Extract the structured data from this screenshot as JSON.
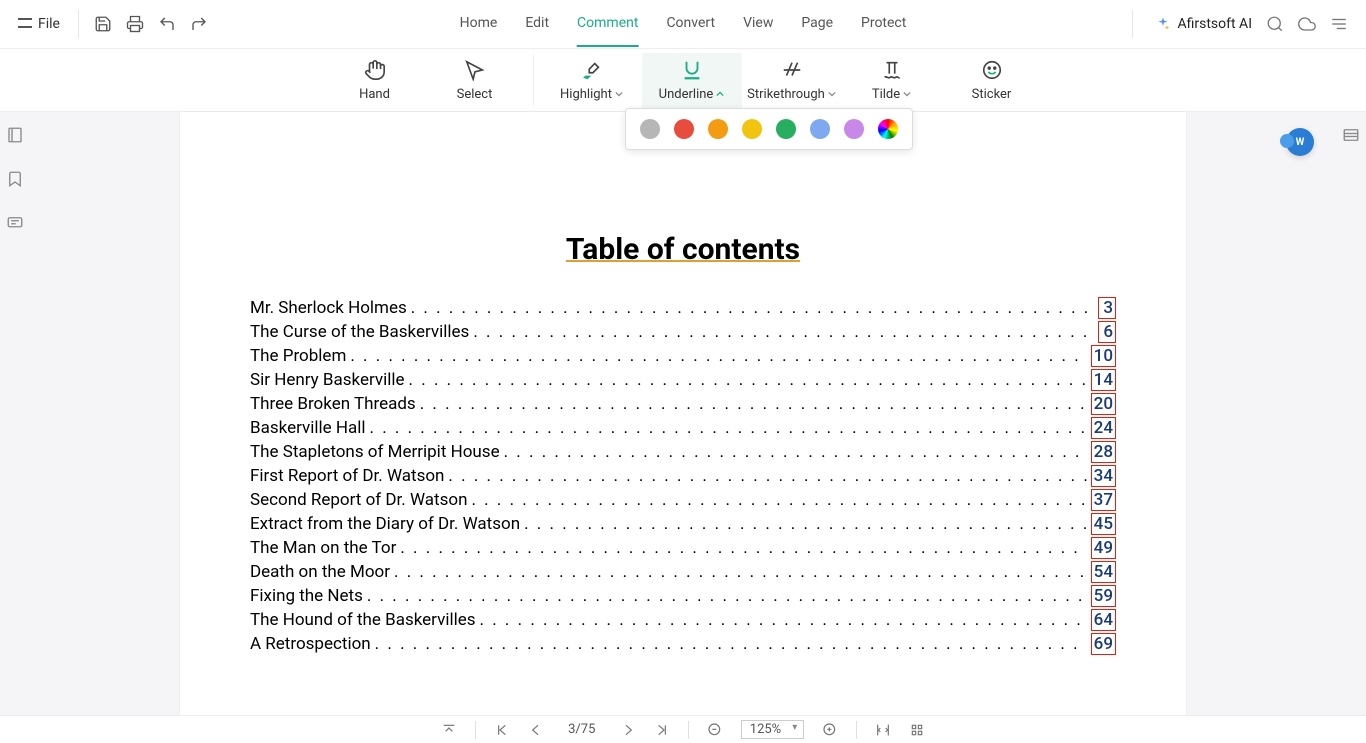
{
  "topbar": {
    "file_label": "File"
  },
  "tabs": {
    "home": "Home",
    "edit": "Edit",
    "comment": "Comment",
    "convert": "Convert",
    "view": "View",
    "page": "Page",
    "protect": "Protect"
  },
  "ai_label": "Afirstsoft AI",
  "ribbon": {
    "hand": "Hand",
    "select": "Select",
    "highlight": "Highlight",
    "underline": "Underline",
    "strike": "Strikethrough",
    "tilde": "Tilde",
    "sticker": "Sticker"
  },
  "colors": {
    "gray": "#b6b6b6",
    "red": "#e74c3c",
    "orange": "#f39c12",
    "yellow": "#f1c40f",
    "green": "#27ae60",
    "blue": "#7ea8f0",
    "purple": "#c888e8",
    "rainbow": "conic-gradient(red,orange,yellow,green,cyan,blue,magenta,red)"
  },
  "document": {
    "toc_title": "Table of contents",
    "entries": [
      {
        "title": "Mr. Sherlock Holmes",
        "page": "3"
      },
      {
        "title": "The Curse of the Baskervilles",
        "page": "6"
      },
      {
        "title": "The Problem",
        "page": "10"
      },
      {
        "title": "Sir Henry Baskerville",
        "page": "14"
      },
      {
        "title": "Three Broken Threads",
        "page": "20"
      },
      {
        "title": "Baskerville Hall",
        "page": "24"
      },
      {
        "title": "The Stapletons of Merripit House",
        "page": "28"
      },
      {
        "title": "First Report of Dr. Watson",
        "page": "34"
      },
      {
        "title": "Second Report of Dr. Watson",
        "page": "37"
      },
      {
        "title": "Extract from the Diary of Dr. Watson",
        "page": "45"
      },
      {
        "title": "The Man on the Tor",
        "page": "49"
      },
      {
        "title": "Death on the Moor",
        "page": "54"
      },
      {
        "title": "Fixing the Nets",
        "page": "59"
      },
      {
        "title": "The Hound of the Baskervilles",
        "page": "64"
      },
      {
        "title": "A Retrospection",
        "page": "69"
      }
    ]
  },
  "statusbar": {
    "page_indicator": "3/75",
    "zoom": "125%"
  }
}
